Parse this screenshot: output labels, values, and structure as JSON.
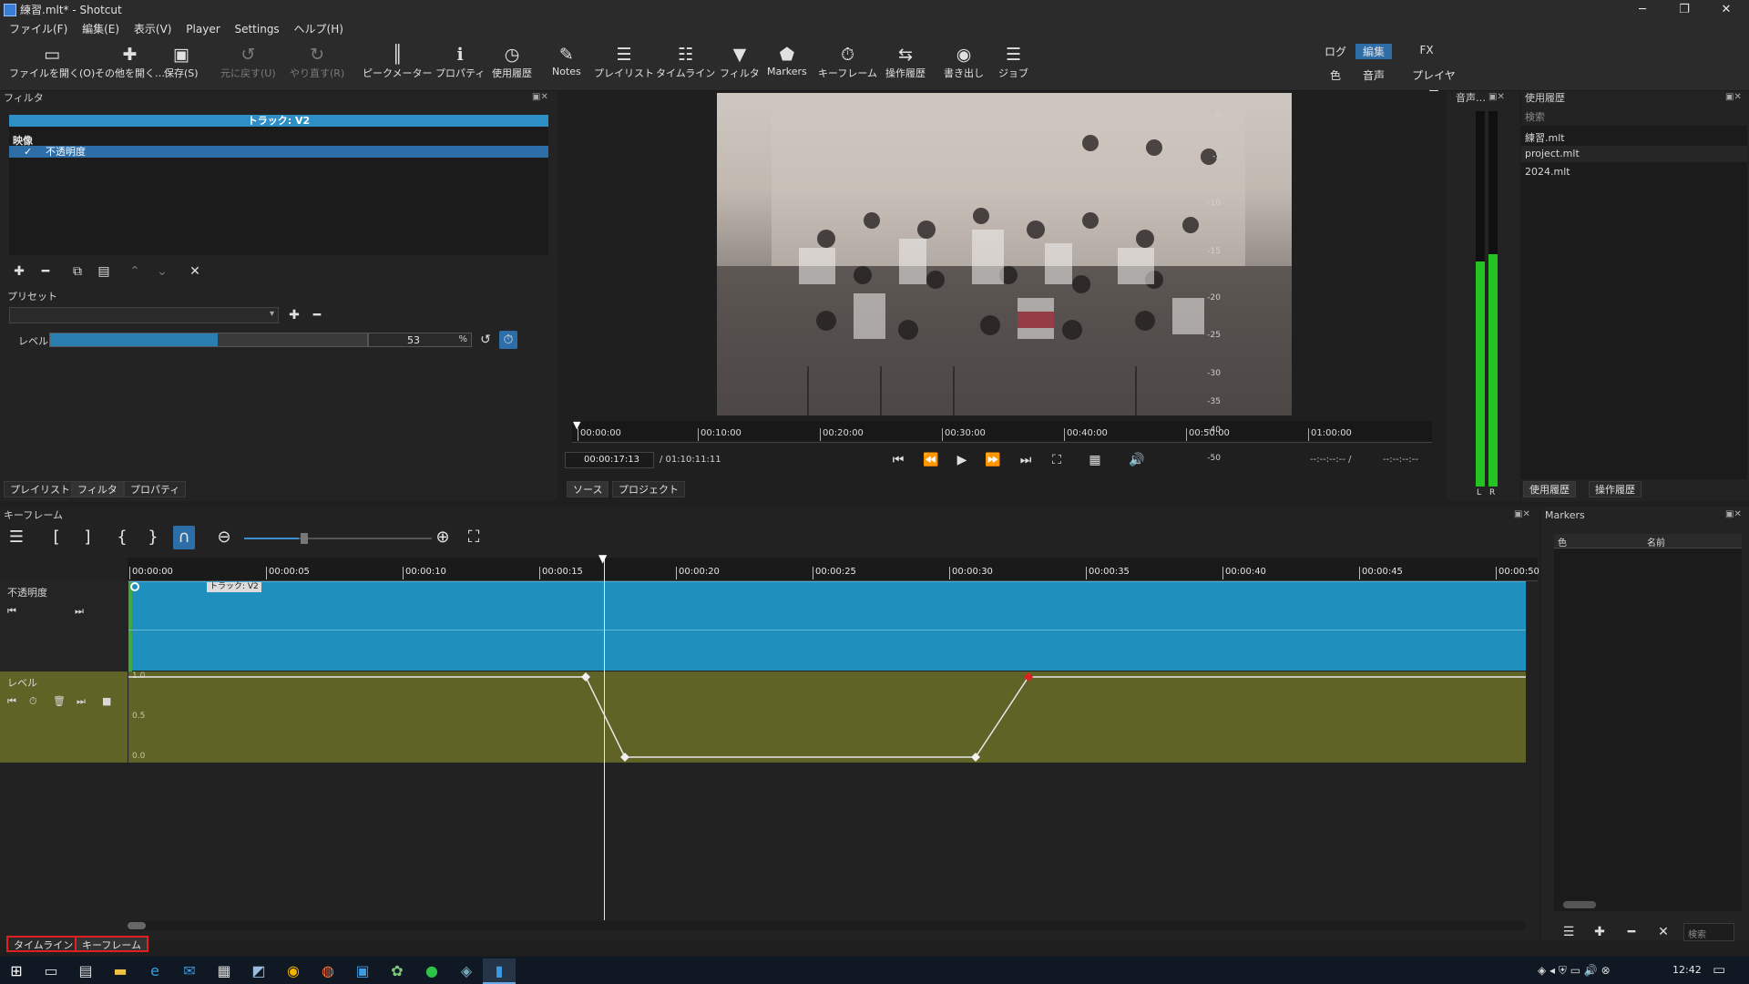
{
  "window": {
    "title": "練習.mlt* - Shotcut",
    "minimize": "─",
    "restore": "❐",
    "close": "✕"
  },
  "menu": [
    "ファイル(F)",
    "編集(E)",
    "表示(V)",
    "Player",
    "Settings",
    "ヘルプ(H)"
  ],
  "toolbar": {
    "open": "ファイルを開く(O)",
    "open_other": "その他を開く…",
    "save": "保存(S)",
    "undo": "元に戻す(U)",
    "redo": "やり直す(R)",
    "peak_meter": "ピークメーター",
    "properties": "プロパティ",
    "recent": "使用履歴",
    "notes": "Notes",
    "playlist": "プレイリスト",
    "timeline": "タイムライン",
    "filters": "フィルタ",
    "markers": "Markers",
    "keyframes": "キーフレーム",
    "history": "操作履歴",
    "export": "書き出し",
    "jobs": "ジョブ"
  },
  "layouts": {
    "row1": [
      "ログ",
      "編集",
      "FX"
    ],
    "row2": [
      "色",
      "音声",
      "プレイヤー"
    ],
    "selected": "編集"
  },
  "filters_panel": {
    "title": "フィルタ",
    "track_header": "トラック: V2",
    "section_video": "映像",
    "filter_item": "不透明度",
    "filter_checked": "✓",
    "preset_label": "プリセット",
    "level_label": "レベル",
    "level_value": "53",
    "level_unit": "%",
    "level_percent": 53
  },
  "tabs_left": [
    "プレイリスト",
    "フィルタ",
    "プロパティ"
  ],
  "player": {
    "ruler": [
      "00:00:00",
      "00:10:00",
      "00:20:00",
      "00:30:00",
      "00:40:00",
      "00:50:00",
      "01:00:00"
    ],
    "timecode": "00:00:17:13",
    "duration": "/ 01:10:11:11",
    "in_point": "--:--:--:-- /",
    "out_point": "--:--:--:--",
    "tab_source": "ソース",
    "tab_project": "プロジェクト"
  },
  "audio_meter": {
    "title": "音声…",
    "scale": [
      "0",
      "-5",
      "-10",
      "-15",
      "-20",
      "-25",
      "-30",
      "-35",
      "-40",
      "-50"
    ],
    "left": "L",
    "right": "R",
    "level_left": 0.6,
    "level_right": 0.62
  },
  "recent_panel": {
    "title": "使用履歴",
    "search_placeholder": "検索",
    "items": [
      "練習.mlt",
      "project.mlt",
      "2024.mlt"
    ],
    "tab_recent": "使用履歴",
    "tab_history": "操作履歴"
  },
  "keyframes_panel": {
    "title": "キーフレーム",
    "ruler": [
      "00:00:00",
      "00:00:05",
      "00:00:10",
      "00:00:15",
      "00:00:20",
      "00:00:25",
      "00:00:30",
      "00:00:35",
      "00:00:40",
      "00:00:45",
      "00:00:50"
    ],
    "track_opacity": "不透明度",
    "clip_label": "トラック: V2",
    "param_level": "レベル",
    "axis_1": "1.0",
    "axis_05": "0.5",
    "axis_0": "0.0"
  },
  "markers_panel": {
    "title": "Markers",
    "col_color": "色",
    "col_name": "名前",
    "search_placeholder": "検索"
  },
  "bottom_tabs": [
    "タイムライン",
    "キーフレーム"
  ],
  "taskbar": {
    "time": "12:42"
  },
  "colors": {
    "accent": "#2e6ea8",
    "clip": "#1f8fbd",
    "param_track": "#5f6326",
    "keyframe_selected": "#e02020",
    "meter": "#22c322"
  }
}
